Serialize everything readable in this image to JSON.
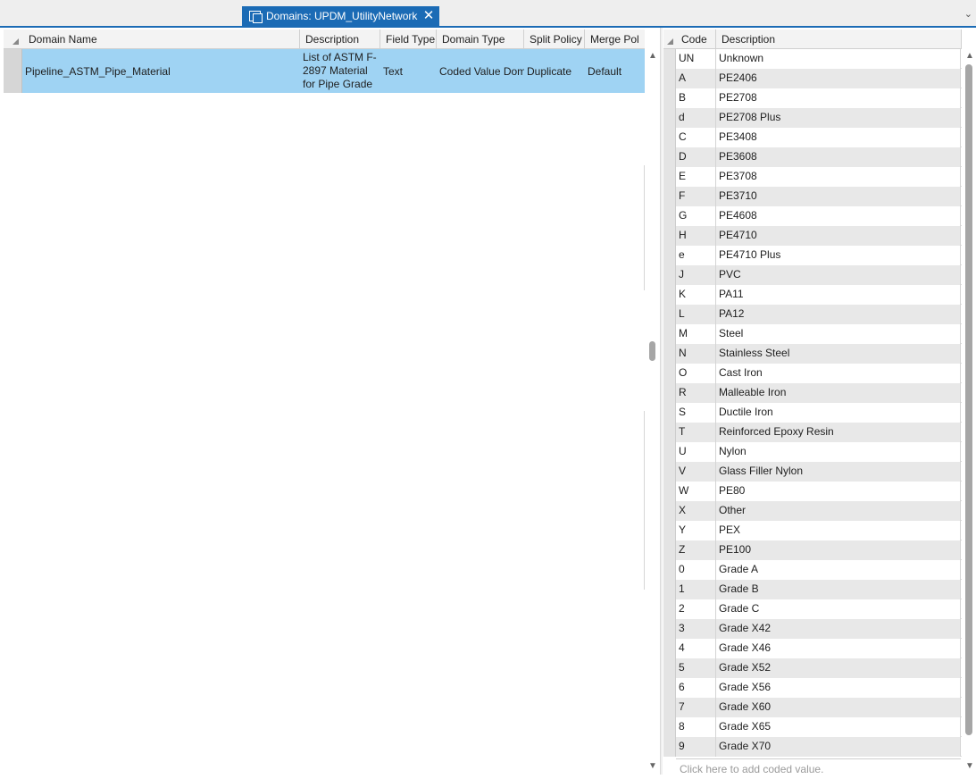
{
  "tab": {
    "title": "Domains: UPDM_UtilityNetwork",
    "icon": "domains-icon",
    "close_glyph": "✕"
  },
  "tab_menu_glyph": "⌄",
  "domains_table": {
    "columns": [
      "Domain Name",
      "Description",
      "Field Type",
      "Domain Type",
      "Split Policy",
      "Merge Pol"
    ],
    "rows": [
      {
        "domain_name": "Pipeline_ASTM_Pipe_Material",
        "description": "List of ASTM F-2897 Material for Pipe Grade",
        "field_type": "Text",
        "domain_type": "Coded Value Dom",
        "split_policy": "Duplicate",
        "merge_policy": "Default"
      }
    ]
  },
  "coded_values_table": {
    "columns": [
      "Code",
      "Description"
    ],
    "rows": [
      {
        "code": "UN",
        "description": "Unknown"
      },
      {
        "code": "A",
        "description": "PE2406"
      },
      {
        "code": "B",
        "description": "PE2708"
      },
      {
        "code": "d",
        "description": "PE2708 Plus"
      },
      {
        "code": "C",
        "description": "PE3408"
      },
      {
        "code": "D",
        "description": "PE3608"
      },
      {
        "code": "E",
        "description": "PE3708"
      },
      {
        "code": "F",
        "description": "PE3710"
      },
      {
        "code": "G",
        "description": "PE4608"
      },
      {
        "code": "H",
        "description": "PE4710"
      },
      {
        "code": "e",
        "description": "PE4710 Plus"
      },
      {
        "code": "J",
        "description": "PVC"
      },
      {
        "code": "K",
        "description": "PA11"
      },
      {
        "code": "L",
        "description": "PA12"
      },
      {
        "code": "M",
        "description": "Steel"
      },
      {
        "code": "N",
        "description": "Stainless Steel"
      },
      {
        "code": "O",
        "description": "Cast Iron"
      },
      {
        "code": "R",
        "description": "Malleable Iron"
      },
      {
        "code": "S",
        "description": "Ductile Iron"
      },
      {
        "code": "T",
        "description": "Reinforced Epoxy Resin"
      },
      {
        "code": "U",
        "description": "Nylon"
      },
      {
        "code": "V",
        "description": "Glass Filler Nylon"
      },
      {
        "code": "W",
        "description": "PE80"
      },
      {
        "code": "X",
        "description": "Other"
      },
      {
        "code": "Y",
        "description": "PEX"
      },
      {
        "code": "Z",
        "description": "PE100"
      },
      {
        "code": "0",
        "description": "Grade A"
      },
      {
        "code": "1",
        "description": "Grade B"
      },
      {
        "code": "2",
        "description": "Grade C"
      },
      {
        "code": "3",
        "description": "Grade X42"
      },
      {
        "code": "4",
        "description": "Grade X46"
      },
      {
        "code": "5",
        "description": "Grade X52"
      },
      {
        "code": "6",
        "description": "Grade X56"
      },
      {
        "code": "7",
        "description": "Grade X60"
      },
      {
        "code": "8",
        "description": "Grade X65"
      },
      {
        "code": "9",
        "description": "Grade X70"
      }
    ],
    "new_row_placeholder": "Click here to add coded value."
  },
  "colors": {
    "accent": "#1b6bb5",
    "selected_row": "#9fd3f3",
    "alt_row": "#e8e8e8"
  }
}
